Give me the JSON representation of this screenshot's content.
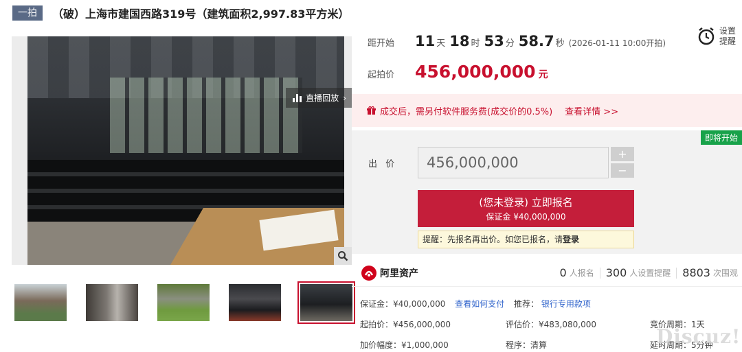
{
  "header": {
    "badge": "一拍",
    "title": "（破）上海市建国西路319号（建筑面积2,997.83平方米）"
  },
  "gallery": {
    "live_label": "直播回放",
    "live_arrow": "›",
    "thumb_count_active": 5
  },
  "countdown": {
    "label": "距开始",
    "days": "11",
    "days_unit": "天",
    "hours": "18",
    "hours_unit": "时",
    "minutes": "53",
    "minutes_unit": "分",
    "seconds": "58.7",
    "seconds_unit": "秒",
    "start_time": "(2026-01-11 10:00开拍)"
  },
  "remind": {
    "label": "设置提醒"
  },
  "start_price": {
    "label": "起拍价",
    "value": "456,000,000",
    "unit": "元"
  },
  "notice": {
    "text": "成交后，需另付软件服务费(成交价的0.5%)",
    "link": "查看详情 >>"
  },
  "bid": {
    "status_tag": "即将开始",
    "label": "出 价",
    "input_value": "456,000,000",
    "plus": "+",
    "minus": "−",
    "signup_main": "(您未登录) 立即报名",
    "signup_sub": "保证金 ¥40,000,000",
    "tip_prefix": "提醒：先报名再出价。如您已报名，请",
    "tip_login": "登录"
  },
  "platform": {
    "name": "阿里资产"
  },
  "stats": {
    "signups": "0",
    "signups_label": "人报名",
    "reminders": "300",
    "reminders_label": "人设置提醒",
    "views": "8803",
    "views_label": "次围观"
  },
  "details": {
    "deposit": "保证金：¥40,000,000",
    "deposit_link": "查看如何支付",
    "recommend_label": "推荐：",
    "recommend_link": "银行专用款项",
    "start_price": "起拍价：¥456,000,000",
    "appraisal": "评估价：¥483,080,000",
    "cycle": "竞价周期：1天",
    "increment": "加价幅度：¥1,000,000",
    "procedure": "程序：清算",
    "delay": "延时周期：5分钟"
  },
  "watermark": "Discuz!",
  "colors": {
    "accent": "#c8102e",
    "badge": "#5a6a86",
    "green": "#18a24a"
  }
}
